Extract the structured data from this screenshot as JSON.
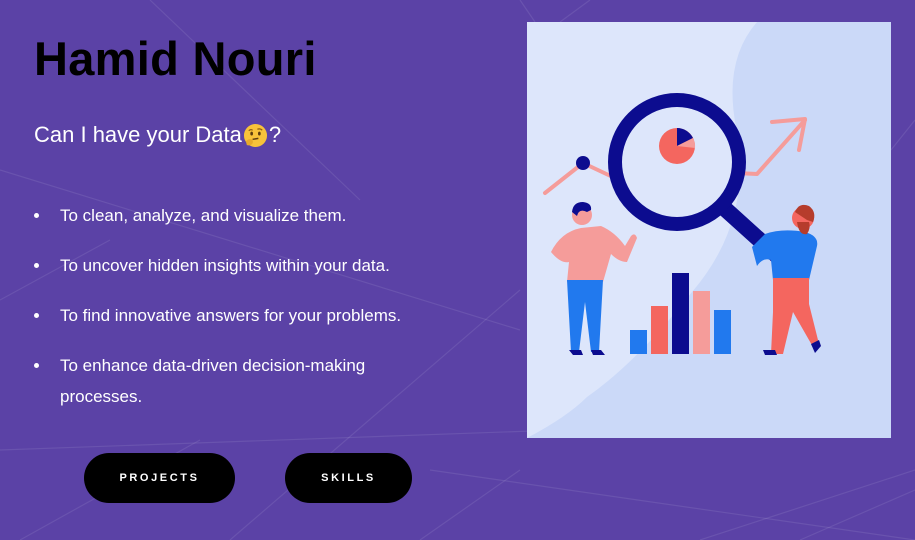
{
  "profile": {
    "name": "Hamid Nouri",
    "tagline_prefix": "Can I have your Data",
    "tagline_suffix": "?",
    "tagline_emoji": "thinking-face-icon"
  },
  "bullets": [
    "To clean, analyze, and visualize them.",
    "To uncover hidden insights within your data.",
    "To find innovative answers for your problems.",
    "To enhance data-driven decision-making processes."
  ],
  "buttons": {
    "projects": "PROJECTS",
    "skills": "SKILLS"
  },
  "colors": {
    "background": "#5b42a6",
    "button": "#000000",
    "illustration_bg": "#dde6fb",
    "navy": "#0c0c8f",
    "coral": "#f4665f",
    "blue": "#2179ee"
  }
}
